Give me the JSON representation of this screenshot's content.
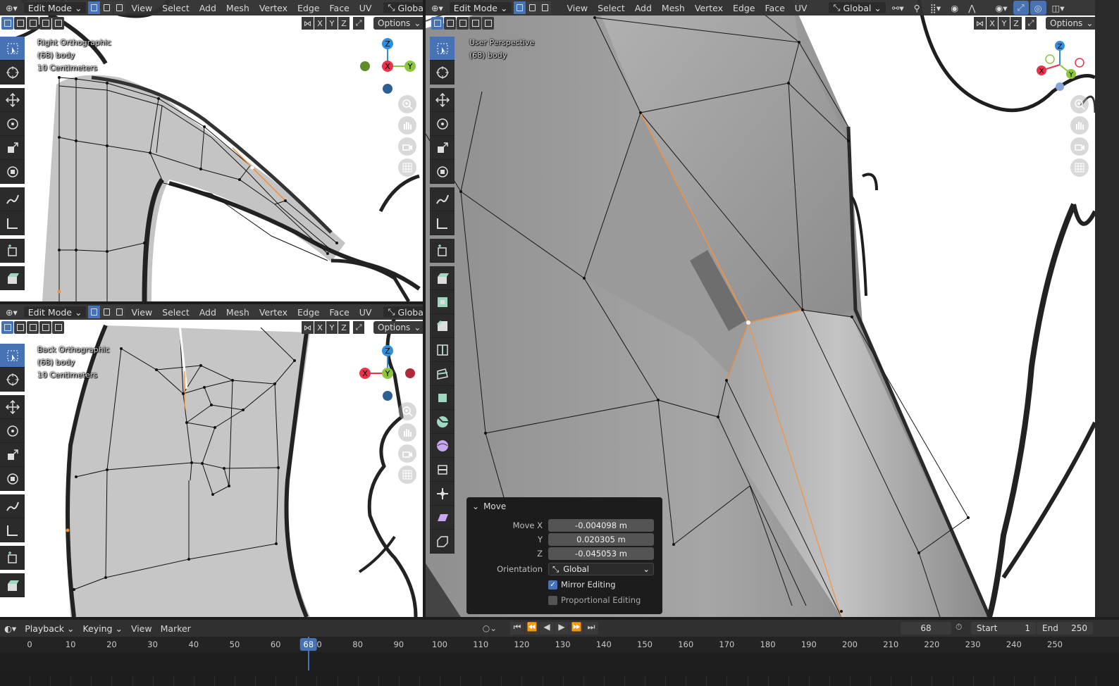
{
  "header": {
    "mode": "Edit Mode",
    "menus": [
      "View",
      "Select",
      "Add",
      "Mesh",
      "Vertex",
      "Edge",
      "Face",
      "UV"
    ],
    "orientation": "Global",
    "orientation_truncated": "Globa",
    "axes": [
      "X",
      "Y",
      "Z"
    ],
    "options_label": "Options"
  },
  "viewports": {
    "top_left": {
      "view_name": "Right Orthographic",
      "object": "(68) body",
      "scale": "10 Centimeters"
    },
    "bottom_left": {
      "view_name": "Back Orthographic",
      "object": "(68) body",
      "scale": "10 Centimeters"
    },
    "right": {
      "view_name": "User Perspective",
      "object": "(68) body"
    }
  },
  "gizmo_labels": {
    "z": "Z",
    "x": "X",
    "y": "Y"
  },
  "move_panel": {
    "title": "Move",
    "move_x_label": "Move X",
    "move_x": "-0.004098 m",
    "y_label": "Y",
    "y": "0.020305 m",
    "z_label": "Z",
    "z": "-0.045053 m",
    "orientation_label": "Orientation",
    "orientation": "Global",
    "mirror_editing": "Mirror Editing",
    "mirror_checked": true,
    "proportional_editing": "Proportional Editing",
    "proportional_checked": false
  },
  "timeline": {
    "menus": [
      "Playback",
      "Keying",
      "View",
      "Marker"
    ],
    "current_frame": "68",
    "start_label": "Start",
    "start": "1",
    "end_label": "End",
    "end": "250",
    "ticks": [
      "0",
      "10",
      "20",
      "30",
      "40",
      "50",
      "60",
      "70",
      "80",
      "90",
      "100",
      "110",
      "120",
      "130",
      "140",
      "150",
      "160",
      "170",
      "180",
      "190",
      "200",
      "210",
      "220",
      "230",
      "240",
      "250"
    ]
  },
  "colors": {
    "accent": "#4772b3",
    "x_axis": "#e8334a",
    "y_axis": "#8cc63f",
    "z_axis": "#2f8fdc",
    "selection": "#f5913c"
  }
}
